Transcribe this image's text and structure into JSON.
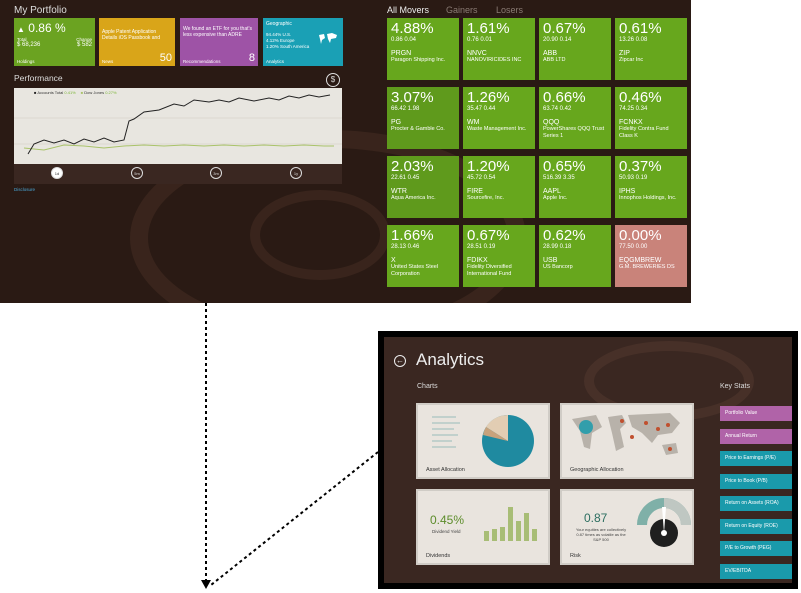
{
  "portfolio": {
    "title": "My Portfolio",
    "holdings_tile": {
      "change_pct": "0.86 %",
      "total_label": "Total",
      "total_value": "$ 68,236",
      "change_label": "Change",
      "change_value": "$ 582",
      "footer": "Holdings",
      "color": "#6ba321"
    },
    "news_tile": {
      "text": "Apple Patent Application Details iOS Passbook and",
      "count": "50",
      "footer": "News",
      "color": "#d9a519"
    },
    "rec_tile": {
      "text": "We found an ETF for you that's less expensive than ADRE",
      "count": "8",
      "footer": "Recommendations",
      "color": "#9e53a6"
    },
    "geo_tile": {
      "title": "Geographic",
      "lines": [
        "94.44% U.S.",
        "4.12% Europe",
        "1.20% South America"
      ],
      "footer": "Analytics",
      "color": "#1aa0b5"
    }
  },
  "performance": {
    "title": "Performance",
    "legend_accounts": "Accounts Total",
    "legend_accounts_val": "0.41%",
    "legend_dow": "Dow Jones",
    "legend_dow_val": "0.27%",
    "range_buttons": [
      "1d",
      "5m",
      "3m",
      "1y"
    ],
    "disclosure": "Disclosure"
  },
  "movers": {
    "tabs": [
      "All Movers",
      "Gainers",
      "Losers"
    ],
    "items": [
      {
        "pct": "4.88%",
        "sub": "0.86  0.04",
        "ticker": "PRGN",
        "name": "Paragon Shipping Inc.",
        "color": "#67a71d"
      },
      {
        "pct": "1.61%",
        "sub": "0.76  0.01",
        "ticker": "NNVC",
        "name": "NANOVIRICIDES INC",
        "color": "#67a71d"
      },
      {
        "pct": "0.67%",
        "sub": "20.90  0.14",
        "ticker": "ABB",
        "name": "ABB LTD",
        "color": "#67a71d"
      },
      {
        "pct": "0.61%",
        "sub": "13.26  0.08",
        "ticker": "ZIP",
        "name": "Zipcar Inc",
        "color": "#67a71d"
      },
      {
        "pct": "3.07%",
        "sub": "66.42  1.98",
        "ticker": "PG",
        "name": "Procter & Gamble Co.",
        "color": "#5f9a1c"
      },
      {
        "pct": "1.26%",
        "sub": "35.47  0.44",
        "ticker": "WM",
        "name": "Waste Management Inc.",
        "color": "#67a71d"
      },
      {
        "pct": "0.66%",
        "sub": "63.74  0.42",
        "ticker": "QQQ",
        "name": "PowerShares QQQ Trust Series 1",
        "color": "#67a71d"
      },
      {
        "pct": "0.46%",
        "sub": "74.25  0.34",
        "ticker": "FCNKX",
        "name": "Fidelity Contra Fund Class K",
        "color": "#67a71d"
      },
      {
        "pct": "2.03%",
        "sub": "22.61  0.45",
        "ticker": "WTR",
        "name": "Aqua America Inc.",
        "color": "#5f9a1c"
      },
      {
        "pct": "1.20%",
        "sub": "45.72  0.54",
        "ticker": "FIRE",
        "name": "Sourcefire, Inc.",
        "color": "#67a71d"
      },
      {
        "pct": "0.65%",
        "sub": "516.39  3.35",
        "ticker": "AAPL",
        "name": "Apple Inc.",
        "color": "#67a71d"
      },
      {
        "pct": "0.37%",
        "sub": "50.93  0.19",
        "ticker": "IPHS",
        "name": "Innophos Holdings, Inc.",
        "color": "#67a71d"
      },
      {
        "pct": "1.66%",
        "sub": "28.13  0.46",
        "ticker": "X",
        "name": "United States Steel Corporation",
        "color": "#67a71d"
      },
      {
        "pct": "0.67%",
        "sub": "28.51  0.19",
        "ticker": "FDIKX",
        "name": "Fidelity Diversified International Fund",
        "color": "#67a71d"
      },
      {
        "pct": "0.62%",
        "sub": "28.99  0.18",
        "ticker": "USB",
        "name": "US Bancorp",
        "color": "#67a71d"
      },
      {
        "pct": "0.00%",
        "sub": "77.50  0.00",
        "ticker": "EQGMBREW",
        "name": "G.M. BREWERIES DS",
        "color": "#c9837a"
      }
    ]
  },
  "analytics": {
    "title": "Analytics",
    "charts_header": "Charts",
    "key_stats_header": "Key Stats",
    "tiles": [
      {
        "label": "Asset Allocation"
      },
      {
        "label": "Geographic Allocation"
      },
      {
        "label": "Dividends",
        "value": "0.45%",
        "sublabel": "Dividend Yield"
      },
      {
        "label": "Risk",
        "value": "0.87",
        "sublabel": "Your equities are collectively 0.87 times as volatile as the S&P 500"
      }
    ],
    "key_stats": [
      {
        "label": "Portfolio Value",
        "color": "#b063a8"
      },
      {
        "label": "Annual Return",
        "color": "#b063a8"
      },
      {
        "label": "Price to Earnings (P/E)",
        "color": "#1a9aab"
      },
      {
        "label": "Price to Book (P/B)",
        "color": "#1a9aab"
      },
      {
        "label": "Return on Assets (ROA)",
        "color": "#1a9aab"
      },
      {
        "label": "Return on Equity (ROE)",
        "color": "#1a9aab"
      },
      {
        "label": "P/E to Growth (PEG)",
        "color": "#1a9aab"
      },
      {
        "label": "EV/EBITDA",
        "color": "#1a9aab"
      }
    ]
  }
}
